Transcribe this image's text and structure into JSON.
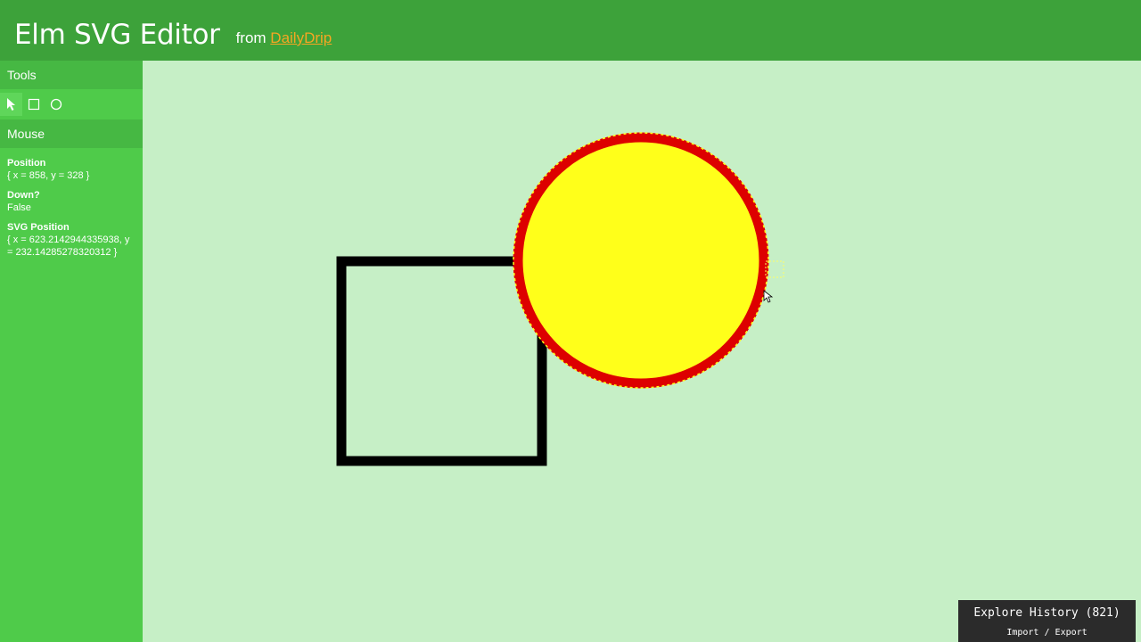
{
  "header": {
    "title": "Elm SVG Editor",
    "from_label": "from",
    "link_text": "DailyDrip"
  },
  "sidebar": {
    "tools_title": "Tools",
    "tools": [
      {
        "icon": "pointer-icon",
        "active": true
      },
      {
        "icon": "square-icon",
        "active": false
      },
      {
        "icon": "circle-icon",
        "active": false
      }
    ],
    "mouse_title": "Mouse",
    "position_label": "Position",
    "position_value": "{ x = 858, y = 328 }",
    "down_label": "Down?",
    "down_value": "False",
    "svg_position_label": "SVG Position",
    "svg_position_value": "{ x = 623.2142944335938, y = 232.14285278320312 }"
  },
  "history": {
    "title": "Explore History (821)",
    "import_label": "Import",
    "separator": "/",
    "export_label": "Export"
  },
  "colors": {
    "header": "#3da23a",
    "sidebar": "#4fcb4a",
    "canvas": "#c6efc6",
    "circle_fill": "#ffff1a",
    "circle_stroke": "#dd0000",
    "rect_stroke": "#000000",
    "link": "#f5a623"
  }
}
